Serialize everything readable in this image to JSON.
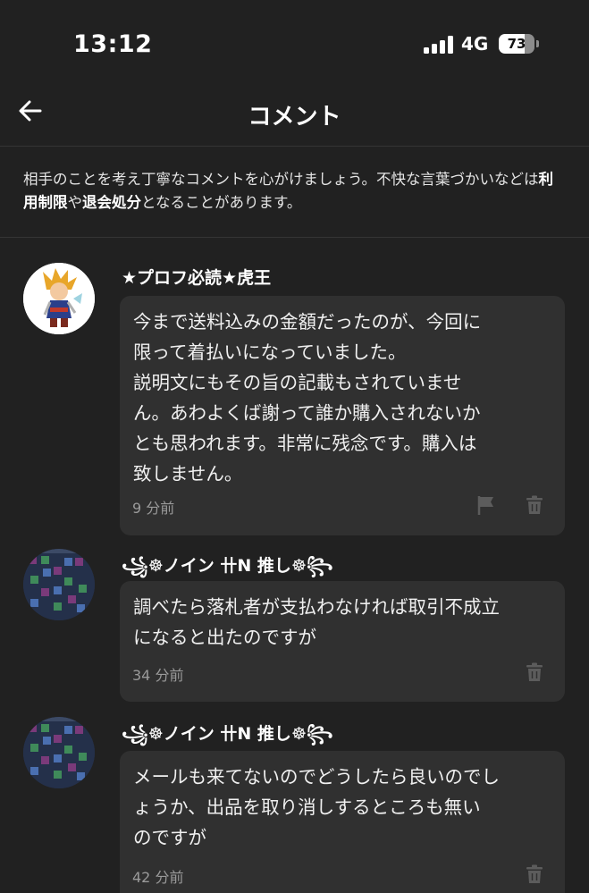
{
  "status_bar": {
    "time": "13:12",
    "network": "4G",
    "battery": "73",
    "battery_level_percent": 73
  },
  "header": {
    "title": "コメント",
    "back_icon": "arrow-left-icon"
  },
  "notice": {
    "text_1": "相手のことを考え丁寧なコメントを心がけましょう。不快な言葉づかいなどは",
    "bold_1": "利用制限",
    "text_2": "や",
    "bold_2": "退会処分",
    "text_3": "となることがあります。"
  },
  "comments": [
    {
      "author": "★プロフ必読★虎王",
      "text": "今まで送料込みの金額だったのが、今回に\n限って着払いになっていました。\n説明文にもその旨の記載もされていませ\nん。あわよくば謝って誰か購入されないか\nとも思われます。非常に残念です。購入は\n致しません。",
      "time": "9 分前",
      "icons": [
        "flag-icon",
        "trash-icon"
      ]
    },
    {
      "author": "꧁☸ノイン 卄N 推し☸꧂",
      "text": "調べたら落札者が支払わなければ取引不成立\nになると出たのですが",
      "time": "34 分前",
      "icons": [
        "trash-icon"
      ]
    },
    {
      "author": "꧁☸ノイン 卄N 推し☸꧂",
      "text": "メールも来てないのでどうしたら良いのでし\nょうか、出品を取り消しするところも無い\nのですが",
      "time": "42 分前",
      "icons": [
        "trash-icon"
      ]
    }
  ],
  "colors": {
    "background": "#212121",
    "bubble": "#303030",
    "divider": "#353535",
    "secondary_text": "#9a9a9a",
    "icon_gray": "#5c5c5c"
  }
}
